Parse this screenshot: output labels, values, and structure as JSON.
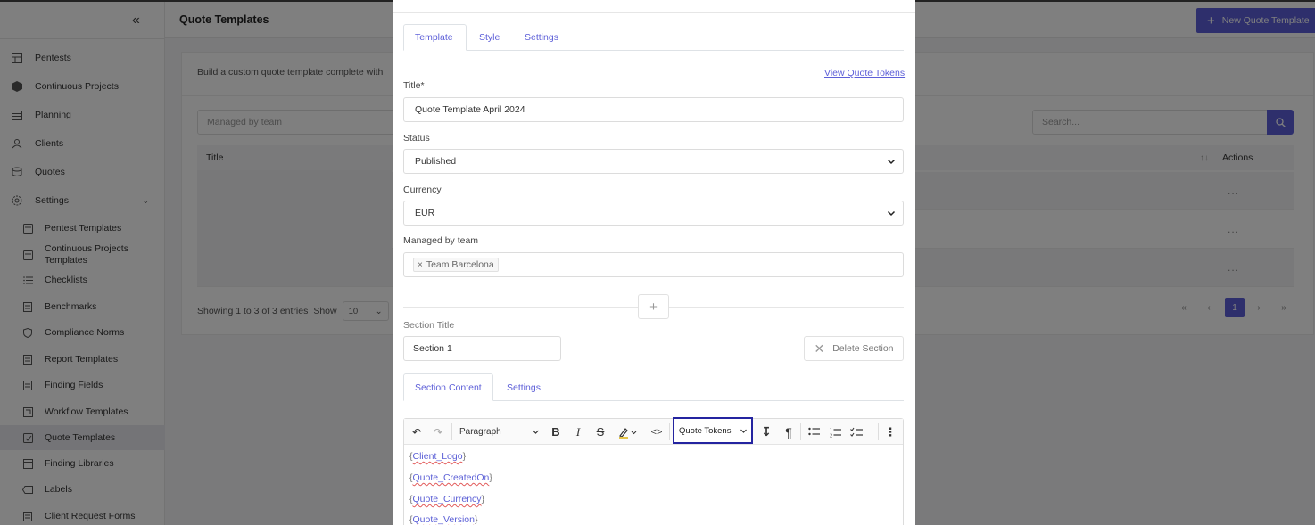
{
  "header": {
    "page_title": "Quote Templates",
    "new_button_label": "New Quote Template"
  },
  "sidebar": {
    "items": [
      {
        "label": "Pentests",
        "icon": "table-icon"
      },
      {
        "label": "Continuous Projects",
        "icon": "box-icon"
      },
      {
        "label": "Planning",
        "icon": "calendar-icon"
      },
      {
        "label": "Clients",
        "icon": "users-icon"
      },
      {
        "label": "Quotes",
        "icon": "coins-icon"
      },
      {
        "label": "Settings",
        "icon": "gear-icon"
      }
    ],
    "sub_items": [
      {
        "label": "Pentest Templates"
      },
      {
        "label": "Continuous Projects Templates"
      },
      {
        "label": "Checklists"
      },
      {
        "label": "Benchmarks"
      },
      {
        "label": "Compliance Norms"
      },
      {
        "label": "Report Templates"
      },
      {
        "label": "Finding Fields"
      },
      {
        "label": "Workflow Templates"
      },
      {
        "label": "Quote Templates",
        "active": true
      },
      {
        "label": "Finding Libraries"
      },
      {
        "label": "Labels"
      },
      {
        "label": "Client Request Forms"
      }
    ]
  },
  "list": {
    "description": "Build a custom quote template complete with",
    "filter_placeholder": "Managed by team",
    "search_placeholder": "Search...",
    "col_title": "Title",
    "col_actions": "Actions",
    "row_action": "...",
    "entries_text": "Showing 1 to 3 of 3 entries",
    "show_label": "Show",
    "page_size": "10",
    "current_page": "1"
  },
  "modal": {
    "tabs": [
      "Template",
      "Style",
      "Settings"
    ],
    "view_tokens_link": "View Quote Tokens",
    "title_label": "Title*",
    "title_value": "Quote Template April 2024",
    "status_label": "Status",
    "status_value": "Published",
    "currency_label": "Currency",
    "currency_value": "EUR",
    "team_label": "Managed by team",
    "team_chip": "Team Barcelona",
    "section_title_label": "Section Title",
    "section_title_value": "Section 1",
    "delete_section_label": "Delete Section",
    "section_tabs": [
      "Section Content",
      "Settings"
    ],
    "editor": {
      "paragraph_label": "Paragraph",
      "tokens_dropdown": "Quote Tokens",
      "lines": [
        "Client_Logo",
        "Quote_CreatedOn",
        "Quote_Currency",
        "Quote_Version"
      ]
    }
  },
  "colors": {
    "accent": "#5d5fd8",
    "highlight_border": "#2424a0"
  }
}
